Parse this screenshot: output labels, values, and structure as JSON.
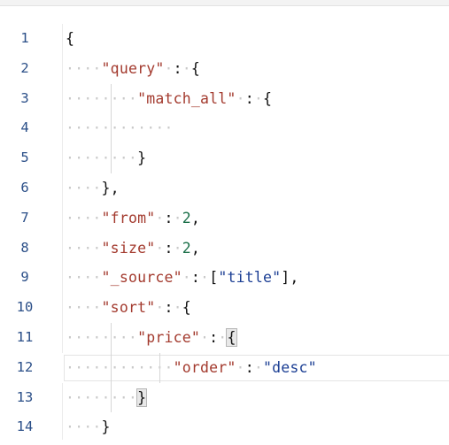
{
  "editor": {
    "lines": [
      {
        "num": "1",
        "indent": "",
        "parts": [
          {
            "t": "punc",
            "v": "{"
          }
        ]
      },
      {
        "num": "2",
        "indent": "····",
        "parts": [
          {
            "t": "key",
            "v": "\"query\""
          },
          {
            "t": "ws",
            "v": "·"
          },
          {
            "t": "punc",
            "v": ":"
          },
          {
            "t": "ws",
            "v": "·"
          },
          {
            "t": "punc",
            "v": "{"
          }
        ]
      },
      {
        "num": "3",
        "indent": "········",
        "parts": [
          {
            "t": "key",
            "v": "\"match_all\""
          },
          {
            "t": "ws",
            "v": "·"
          },
          {
            "t": "punc",
            "v": ":"
          },
          {
            "t": "ws",
            "v": "·"
          },
          {
            "t": "punc",
            "v": "{"
          }
        ]
      },
      {
        "num": "4",
        "indent": "············",
        "parts": []
      },
      {
        "num": "5",
        "indent": "········",
        "parts": [
          {
            "t": "punc",
            "v": "}"
          }
        ]
      },
      {
        "num": "6",
        "indent": "····",
        "parts": [
          {
            "t": "punc",
            "v": "},"
          }
        ]
      },
      {
        "num": "7",
        "indent": "····",
        "parts": [
          {
            "t": "key",
            "v": "\"from\""
          },
          {
            "t": "ws",
            "v": "·"
          },
          {
            "t": "punc",
            "v": ":"
          },
          {
            "t": "ws",
            "v": "·"
          },
          {
            "t": "num",
            "v": "2"
          },
          {
            "t": "punc",
            "v": ","
          }
        ]
      },
      {
        "num": "8",
        "indent": "····",
        "parts": [
          {
            "t": "key",
            "v": "\"size\""
          },
          {
            "t": "ws",
            "v": "·"
          },
          {
            "t": "punc",
            "v": ":"
          },
          {
            "t": "ws",
            "v": "·"
          },
          {
            "t": "num",
            "v": "2"
          },
          {
            "t": "punc",
            "v": ","
          }
        ]
      },
      {
        "num": "9",
        "indent": "····",
        "parts": [
          {
            "t": "key",
            "v": "\"_source\""
          },
          {
            "t": "ws",
            "v": "·"
          },
          {
            "t": "punc",
            "v": ":"
          },
          {
            "t": "ws",
            "v": "·"
          },
          {
            "t": "punc",
            "v": "["
          },
          {
            "t": "str",
            "v": "\"title\""
          },
          {
            "t": "punc",
            "v": "],"
          }
        ]
      },
      {
        "num": "10",
        "indent": "····",
        "parts": [
          {
            "t": "key",
            "v": "\"sort\""
          },
          {
            "t": "ws",
            "v": "·"
          },
          {
            "t": "punc",
            "v": ":"
          },
          {
            "t": "ws",
            "v": "·"
          },
          {
            "t": "punc",
            "v": "{"
          }
        ]
      },
      {
        "num": "11",
        "indent": "········",
        "parts": [
          {
            "t": "key",
            "v": "\"price\""
          },
          {
            "t": "ws",
            "v": "·"
          },
          {
            "t": "punc",
            "v": ":"
          },
          {
            "t": "ws",
            "v": "·"
          },
          {
            "t": "hl",
            "v": "{"
          }
        ]
      },
      {
        "num": "12",
        "indent": "············",
        "parts": [
          {
            "t": "key",
            "v": "\"order\""
          },
          {
            "t": "ws",
            "v": "·"
          },
          {
            "t": "punc",
            "v": ":"
          },
          {
            "t": "ws",
            "v": "·"
          },
          {
            "t": "str",
            "v": "\"desc\""
          }
        ],
        "active": true
      },
      {
        "num": "13",
        "indent": "········",
        "parts": [
          {
            "t": "hl",
            "v": "}"
          }
        ]
      },
      {
        "num": "14",
        "indent": "····",
        "parts": [
          {
            "t": "punc",
            "v": "}"
          }
        ]
      }
    ]
  }
}
